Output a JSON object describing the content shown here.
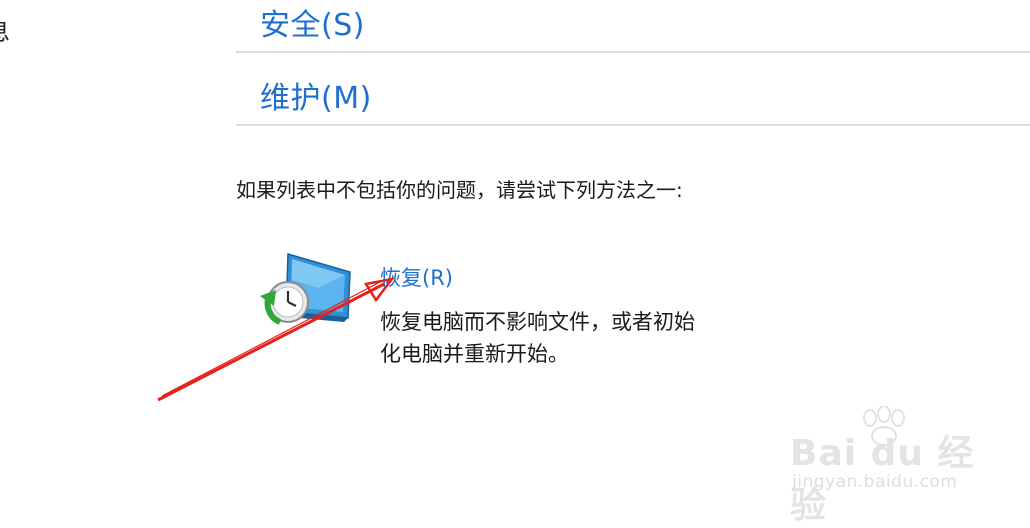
{
  "left_partial_text": "息",
  "links": {
    "security": "安全(S)",
    "maintenance": "维护(M)"
  },
  "hint_text": "如果列表中不包括你的问题，请尝试下列方法之一:",
  "recovery": {
    "title": "恢复(R)",
    "description_line1": "恢复电脑而不影响文件，或者初始",
    "description_line2": "化电脑并重新开始。",
    "icon": "system-restore-icon"
  },
  "annotation": {
    "arrow_color": "#e8201a"
  },
  "watermark": {
    "main": "Bai du 经验",
    "sub": "jingyan.baidu.com"
  },
  "colors": {
    "link": "#1e6fd0",
    "divider": "#dcdcdc"
  }
}
